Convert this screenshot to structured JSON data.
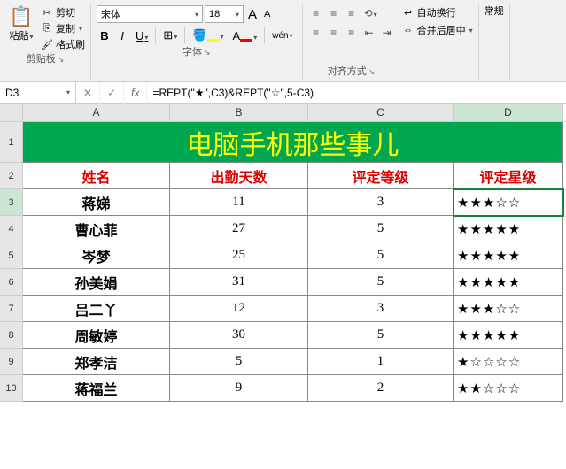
{
  "ribbon": {
    "clipboard": {
      "paste": "粘贴",
      "cut": "剪切",
      "copy": "复制",
      "format_painter": "格式刷",
      "group_label": "剪贴板"
    },
    "font": {
      "name": "宋体",
      "size": "18",
      "increase": "A",
      "decrease": "A",
      "bold": "B",
      "italic": "I",
      "underline": "U",
      "border": "⊞",
      "fill": "🖍",
      "color": "A",
      "phonetic": "wén",
      "group_label": "字体"
    },
    "align": {
      "wrap": "自动换行",
      "merge": "合并后居中",
      "group_label": "对齐方式"
    },
    "general": {
      "label": "常规"
    }
  },
  "namebox": "D3",
  "formula": "=REPT(\"★\",C3)&REPT(\"☆\",5-C3)",
  "columns": [
    "A",
    "B",
    "C",
    "D"
  ],
  "title": "电脑手机那些事儿",
  "headers": {
    "a": "姓名",
    "b": "出勤天数",
    "c": "评定等级",
    "d": "评定星级"
  },
  "rows": [
    {
      "n": "3",
      "a": "蒋娣",
      "b": "11",
      "c": "3",
      "d": "★★★☆☆"
    },
    {
      "n": "4",
      "a": "曹心菲",
      "b": "27",
      "c": "5",
      "d": "★★★★★"
    },
    {
      "n": "5",
      "a": "岑梦",
      "b": "25",
      "c": "5",
      "d": "★★★★★"
    },
    {
      "n": "6",
      "a": "孙美娟",
      "b": "31",
      "c": "5",
      "d": "★★★★★"
    },
    {
      "n": "7",
      "a": "吕二丫",
      "b": "12",
      "c": "3",
      "d": "★★★☆☆"
    },
    {
      "n": "8",
      "a": "周敏婷",
      "b": "30",
      "c": "5",
      "d": "★★★★★"
    },
    {
      "n": "9",
      "a": "郑孝洁",
      "b": "5",
      "c": "1",
      "d": "★☆☆☆☆"
    },
    {
      "n": "10",
      "a": "蒋福兰",
      "b": "9",
      "c": "2",
      "d": "★★☆☆☆"
    }
  ],
  "icons": {
    "paste": "📋",
    "cut": "✂",
    "copy": "⎘",
    "brush": "🖌",
    "wrap": "↩",
    "merge": "⇔",
    "dropdown": "▾",
    "fx": "fx",
    "check": "✓",
    "x": "✕",
    "expander": "↘"
  },
  "row1": "1",
  "row2": "2"
}
